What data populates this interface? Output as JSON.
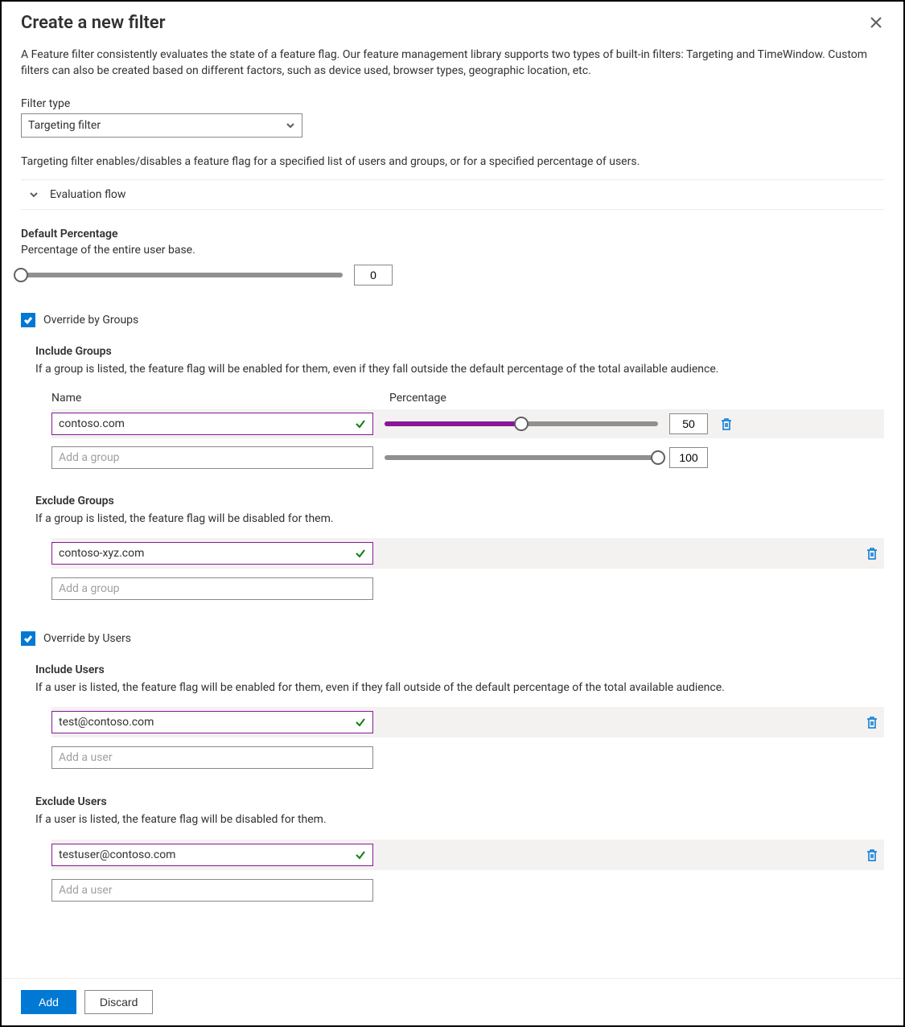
{
  "header": {
    "title": "Create a new filter"
  },
  "description": "A Feature filter consistently evaluates the state of a feature flag. Our feature management library supports two types of built-in filters: Targeting and TimeWindow. Custom filters can also be created based on different factors, such as device used, browser types, geographic location, etc.",
  "filterType": {
    "label": "Filter type",
    "value": "Targeting filter"
  },
  "targetingDescription": "Targeting filter enables/disables a feature flag for a specified list of users and groups, or for a specified percentage of users.",
  "evaluationFlow": {
    "label": "Evaluation flow"
  },
  "defaultPercentage": {
    "heading": "Default Percentage",
    "subtext": "Percentage of the entire user base.",
    "value": "0"
  },
  "overrideGroups": {
    "label": "Override by Groups",
    "checked": true
  },
  "includeGroups": {
    "heading": "Include Groups",
    "desc": "If a group is listed, the feature flag will be enabled for them, even if they fall outside the default percentage of the total available audience.",
    "colName": "Name",
    "colPct": "Percentage",
    "rows": [
      {
        "value": "contoso.com",
        "percentage": "50"
      }
    ],
    "placeholder": "Add a group",
    "placeholderPct": "100"
  },
  "excludeGroups": {
    "heading": "Exclude Groups",
    "desc": "If a group is listed, the feature flag will be disabled for them.",
    "rows": [
      {
        "value": "contoso-xyz.com"
      }
    ],
    "placeholder": "Add a group"
  },
  "overrideUsers": {
    "label": "Override by Users",
    "checked": true
  },
  "includeUsers": {
    "heading": "Include Users",
    "desc": "If a user is listed, the feature flag will be enabled for them, even if they fall outside of the default percentage of the total available audience.",
    "rows": [
      {
        "value": "test@contoso.com"
      }
    ],
    "placeholder": "Add a user"
  },
  "excludeUsers": {
    "heading": "Exclude Users",
    "desc": "If a user is listed, the feature flag will be disabled for them.",
    "rows": [
      {
        "value": "testuser@contoso.com"
      }
    ],
    "placeholder": "Add a user"
  },
  "footer": {
    "add": "Add",
    "discard": "Discard"
  }
}
